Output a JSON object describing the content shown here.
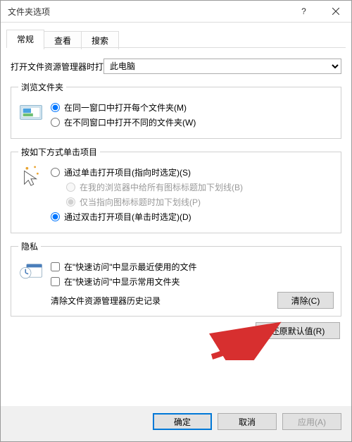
{
  "window": {
    "title": "文件夹选项"
  },
  "tabs": {
    "general": "常规",
    "view": "查看",
    "search": "搜索"
  },
  "openIn": {
    "label": "打开文件资源管理器时打",
    "selected": "此电脑"
  },
  "browse": {
    "legend": "浏览文件夹",
    "sameWindow": "在同一窗口中打开每个文件夹(M)",
    "newWindow": "在不同窗口中打开不同的文件夹(W)"
  },
  "click": {
    "legend": "按如下方式单击项目",
    "single": "通过单击打开项目(指向时选定)(S)",
    "underlineBrowser": "在我的浏览器中给所有图标标题加下划线(B)",
    "underlinePoint": "仅当指向图标标题时加下划线(P)",
    "double": "通过双击打开项目(单击时选定)(D)"
  },
  "privacy": {
    "legend": "隐私",
    "recent": "在\"快速访问\"中显示最近使用的文件",
    "frequent": "在\"快速访问\"中显示常用文件夹",
    "clearLabel": "清除文件资源管理器历史记录",
    "clearBtn": "清除(C)"
  },
  "restore": "还原默认值(R)",
  "footer": {
    "ok": "确定",
    "cancel": "取消",
    "apply": "应用(A)"
  }
}
